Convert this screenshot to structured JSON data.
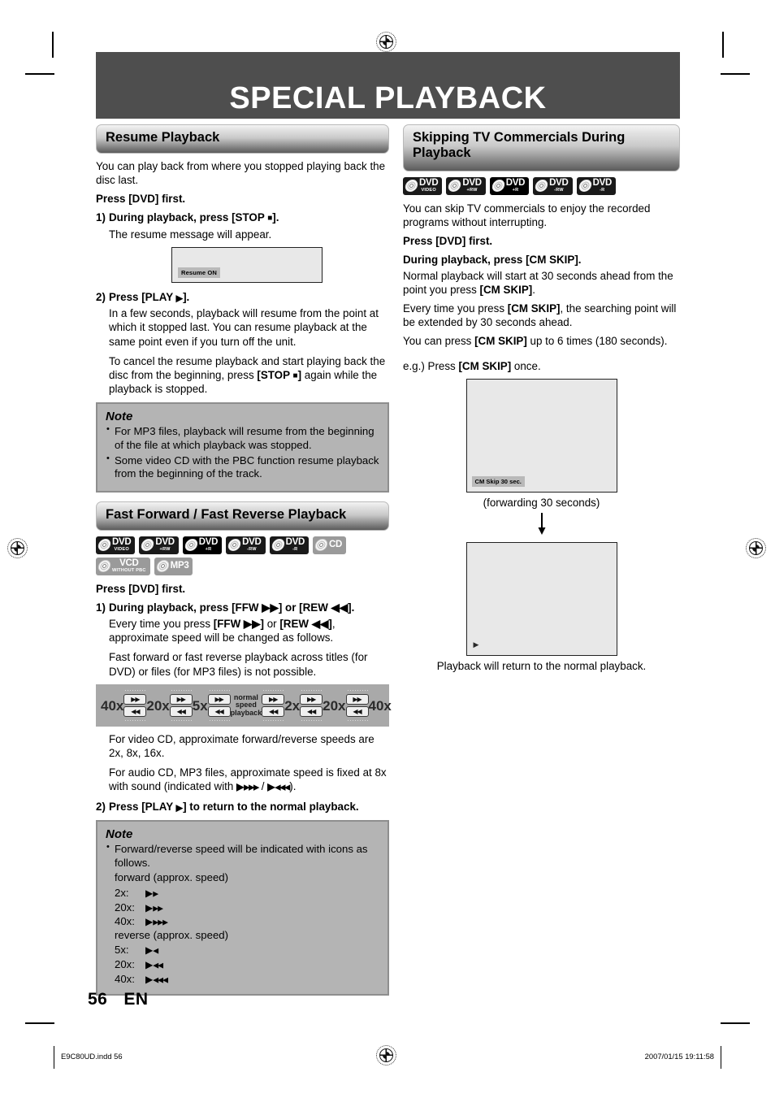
{
  "page": {
    "title": "SPECIAL PLAYBACK",
    "number": "56",
    "locale": "EN"
  },
  "footer": {
    "file": "E9C80UD.indd   56",
    "timestamp": "2007/01/15   19:11:58"
  },
  "left_column": {
    "section1": {
      "heading": "Resume Playback",
      "intro": "You can play back from where you stopped playing back the disc last.",
      "press_first": "Press [DVD] first.",
      "step1": {
        "num": "1)",
        "text_prefix": "During playback, press [STOP ",
        "glyph": "■",
        "text_suffix": "].",
        "detail": "The resume message will appear."
      },
      "osd": {
        "badge": "Resume ON"
      },
      "step2": {
        "num": "2)",
        "text_prefix": "Press [PLAY ",
        "glyph": "▶",
        "text_suffix": "]."
      },
      "step2_detail1": "In a few seconds, playback will resume from the point at which it stopped last. You can resume playback at the same point even if you turn off the unit.",
      "step2_detail2_a": "To cancel the resume playback and start playing back the disc from the beginning, press ",
      "step2_detail2_bold": "[STOP ",
      "step2_detail2_glyph": "■",
      "step2_detail2_boldend": "]",
      "step2_detail2_b": " again while the playback is stopped."
    },
    "note1": {
      "title": "Note",
      "items": [
        "For MP3 files, playback will resume from the beginning of the file at which playback was stopped.",
        "Some video CD with the PBC function resume playback from the beginning of the track."
      ]
    },
    "section2": {
      "heading": "Fast Forward / Fast Reverse Playback",
      "discs": [
        {
          "name": "dvd-video-icon",
          "big": "DVD",
          "sub": "VIDEO",
          "style": "dark"
        },
        {
          "name": "dvd-plus-rw-icon",
          "big": "DVD",
          "sub": "+RW",
          "style": "dark"
        },
        {
          "name": "dvd-plus-r-icon",
          "big": "DVD",
          "sub": "+R",
          "style": "black"
        },
        {
          "name": "dvd-minus-rw-icon",
          "big": "DVD",
          "sub": "-RW",
          "style": "dark"
        },
        {
          "name": "dvd-minus-r-icon",
          "big": "DVD",
          "sub": "-R",
          "style": "dark"
        },
        {
          "name": "cd-icon",
          "big": "CD",
          "sub": "",
          "style": "gray"
        },
        {
          "name": "vcd-icon",
          "big": "VCD",
          "sub": "WITHOUT PBC",
          "style": "gray"
        },
        {
          "name": "mp3-icon",
          "big": "MP3",
          "sub": "",
          "style": "gray"
        }
      ],
      "press_first": "Press [DVD] first.",
      "step1": {
        "num": "1)",
        "text": "During playback, press [FFW ▶▶] or [REW ◀◀]."
      },
      "step1_detail1_a": "Every time you press ",
      "step1_detail1_b": "[FFW ▶▶]",
      "step1_detail1_c": " or ",
      "step1_detail1_d": "[REW ◀◀]",
      "step1_detail1_e": ", approximate speed will be changed as follows.",
      "step1_detail2": "Fast forward or fast reverse playback across titles (for DVD) or files (for MP3 files) is not possible.",
      "speed_diagram": {
        "labels": [
          "40x",
          "20x",
          "5x",
          "normal speed playback",
          "2x",
          "20x",
          "40x"
        ],
        "normal_line1": "normal",
        "normal_line2": "speed",
        "normal_line3": "playback",
        "ffw_glyph": "▶▶",
        "rew_glyph": "◀◀"
      },
      "detail3": "For video CD, approximate forward/reverse speeds are 2x, 8x, 16x.",
      "detail4_a": "For audio CD, MP3 files, approximate speed is fixed at 8x with sound (indicated with ",
      "detail4_fwd_head": "▶",
      "detail4_fwd_tail": "▶▶▶",
      "detail4_mid": " / ",
      "detail4_rev_head": "▶",
      "detail4_rev_tail": "◀◀◀",
      "detail4_b": ").",
      "step2": {
        "num": "2)",
        "text_prefix": "Press [PLAY ",
        "glyph": "▶",
        "text_suffix": "] to return to the normal playback."
      }
    },
    "note2": {
      "title": "Note",
      "intro": "Forward/reverse speed will be indicated with icons as follows.",
      "forward_label": "forward (approx. speed)",
      "forward_rows": [
        {
          "label": "2x:",
          "head": "▶",
          "tail": "▶"
        },
        {
          "label": "20x:",
          "head": "▶",
          "tail": "▶▶"
        },
        {
          "label": "40x:",
          "head": "▶",
          "tail": "▶▶▶"
        }
      ],
      "reverse_label": "reverse (approx. speed)",
      "reverse_rows": [
        {
          "label": "5x:",
          "head": "▶",
          "tail": "◀"
        },
        {
          "label": "20x:",
          "head": "▶",
          "tail": "◀◀"
        },
        {
          "label": "40x:",
          "head": "▶",
          "tail": "◀◀◀"
        }
      ]
    }
  },
  "right_column": {
    "section": {
      "heading_line1": "Skipping TV Commercials During",
      "heading_line2": "Playback",
      "discs": [
        {
          "name": "dvd-video-icon",
          "big": "DVD",
          "sub": "VIDEO",
          "style": "dark"
        },
        {
          "name": "dvd-plus-rw-icon",
          "big": "DVD",
          "sub": "+RW",
          "style": "dark"
        },
        {
          "name": "dvd-plus-r-icon",
          "big": "DVD",
          "sub": "+R",
          "style": "black"
        },
        {
          "name": "dvd-minus-rw-icon",
          "big": "DVD",
          "sub": "-RW",
          "style": "dark"
        },
        {
          "name": "dvd-minus-r-icon",
          "big": "DVD",
          "sub": "-R",
          "style": "dark"
        }
      ],
      "intro": "You can skip TV commercials to enjoy the recorded programs without interrupting.",
      "press_first": "Press [DVD] first.",
      "during": "During playback, press [CM SKIP].",
      "para1_a": "Normal playback will start at 30 seconds ahead from the point you press ",
      "para1_b": "[CM SKIP]",
      "para1_c": ".",
      "para2_a": "Every time you press ",
      "para2_b": "[CM SKIP]",
      "para2_c": ", the searching point will be extended by 30 seconds ahead.",
      "para3_a": "You can press ",
      "para3_b": "[CM SKIP]",
      "para3_c": " up to 6 times (180 seconds).",
      "eg_a": "e.g.) Press ",
      "eg_b": "[CM SKIP]",
      "eg_c": " once.",
      "screen1": {
        "badge": "CM Skip 30 sec."
      },
      "caption1": "(forwarding 30 seconds)",
      "screen2": {
        "playmark": "▶"
      },
      "caption2": "Playback will return to the normal playback."
    }
  }
}
